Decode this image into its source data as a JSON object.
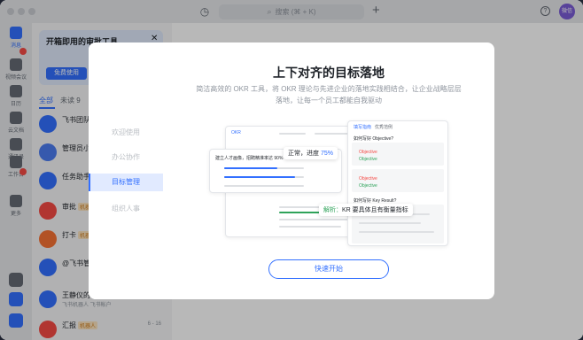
{
  "titlebar": {
    "search_placeholder": "搜索 (⌘ + K)",
    "avatar_text": "微信"
  },
  "rail": {
    "items": [
      {
        "label": "消息",
        "icon": "chat-bubble-icon"
      },
      {
        "label": "视频会议",
        "icon": "video-icon"
      },
      {
        "label": "日历",
        "icon": "calendar-icon"
      },
      {
        "label": "云文档",
        "icon": "cloud-doc-icon"
      },
      {
        "label": "通讯录",
        "icon": "contacts-icon"
      },
      {
        "label": "工作台",
        "icon": "workplace-icon"
      },
      {
        "label": "更多",
        "icon": "more-icon"
      }
    ]
  },
  "promo": {
    "title": "开箱即用的审批工具",
    "button": "免费使用"
  },
  "chat_tabs": {
    "all": "全部",
    "unread": "未读 9"
  },
  "chats": [
    {
      "name": "飞书团队",
      "tag": "",
      "msg": "",
      "time": ""
    },
    {
      "name": "管理员小",
      "tag": "",
      "msg": "",
      "time": ""
    },
    {
      "name": "任务助手",
      "tag": "",
      "msg": "",
      "time": ""
    },
    {
      "name": "审批",
      "tag": "机器人",
      "msg": "",
      "time": ""
    },
    {
      "name": "打卡",
      "tag": "机器人",
      "msg": "",
      "time": ""
    },
    {
      "name": "@飞书管",
      "tag": "",
      "msg": "",
      "time": ""
    },
    {
      "name": "王静仪的",
      "tag": "",
      "msg": "飞书机器人 飞书帐户",
      "time": ""
    },
    {
      "name": "汇报",
      "tag": "机器人",
      "msg": "",
      "time": "6 - 16"
    }
  ],
  "modal": {
    "title": "上下对齐的目标落地",
    "desc": "简洁高效的 OKR 工具，将 OKR 理论与先进企业的落地实践相结合，让企业战略层层落地，让每一个员工都能自我驱动",
    "side_items": [
      "欢迎使用",
      "办公协作",
      "目标管理",
      "组织人事"
    ],
    "active_side_index": 2,
    "start_button": "快速开始",
    "illus": {
      "app_title": "OKR",
      "bubble_progress": "正常，进度 75%",
      "bubble_progress_prefix": "正常，进度 ",
      "bubble_progress_value": "75%",
      "bubble_parse": "解析：KR 要具体且有衡量指标",
      "bubble_parse_prefix": "解析：",
      "bubble_parse_text": "KR 要具体且有衡量指标",
      "objective_text": "建立人才画像，招聘精准率达 90%",
      "panel_tabs": [
        "填写指南",
        "优秀范例"
      ],
      "panel_headings": [
        "如何写好 Objective?",
        "如何写好 Key Result?"
      ],
      "panel_items": [
        "Objective",
        "Objective",
        "Objective",
        "Objective"
      ]
    }
  }
}
